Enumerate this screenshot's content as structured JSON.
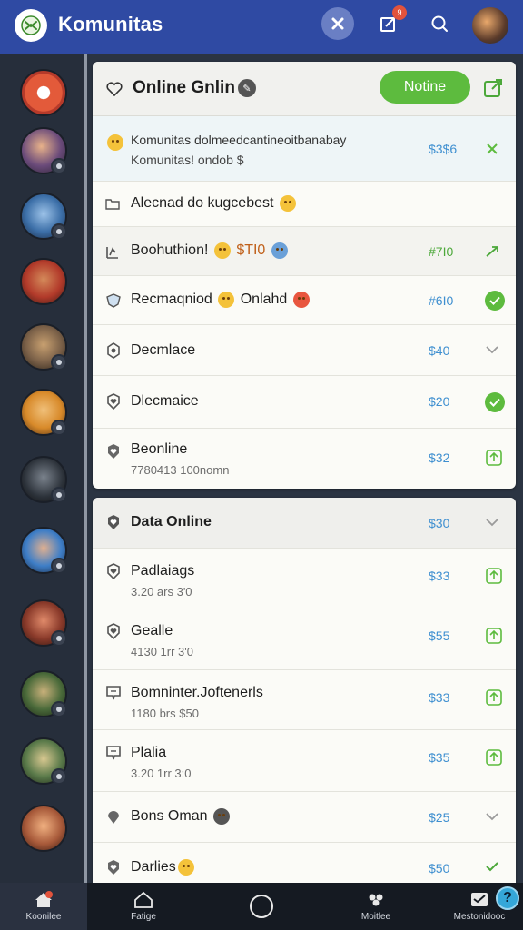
{
  "header": {
    "title": "Komunitas",
    "notification_count": "9"
  },
  "rail": {
    "avatars": [
      {
        "color": "#e35a3a"
      },
      {
        "color": "#6a4a7a"
      },
      {
        "color": "#3c6fa8"
      },
      {
        "color": "#b23a2a"
      },
      {
        "color": "#7a6048"
      },
      {
        "color": "#d88a2a"
      },
      {
        "color": "#2c323a"
      },
      {
        "color": "#3e7ec7"
      },
      {
        "color": "#8a3a2a"
      },
      {
        "color": "#4a6a3a"
      },
      {
        "color": "#5a7a4a"
      },
      {
        "color": "#a85a3a"
      }
    ]
  },
  "panel1": {
    "title": "Online Gnlin",
    "button": "Notine",
    "rows": [
      {
        "label": "Komunitas dolmeedcantineoitbanabay",
        "sub": "Komunitas! ondob $",
        "price": "$3$6"
      },
      {
        "label": "Alecnad do kugcebest"
      },
      {
        "label": "Boohuthion!",
        "tail": "$TI0",
        "price": "#7I0"
      },
      {
        "label": "Recmaqniod",
        "tail": "Onlahd",
        "price": "#6I0"
      },
      {
        "label": "Decmlace",
        "price": "$40"
      },
      {
        "label": "Dlecmaice",
        "price": "$20"
      },
      {
        "label": "Beonline",
        "sub": "7780413 100nomn",
        "price": "$32"
      }
    ]
  },
  "panel2": {
    "title": "Data Online",
    "title_price": "$30",
    "rows": [
      {
        "label": "Padlaiags",
        "sub": "3.20 ars 3'0",
        "price": "$33"
      },
      {
        "label": "Gealle",
        "sub": "4130 1rr 3'0",
        "price": "$55"
      },
      {
        "label": "Bomninter.Joftenerls",
        "sub": "1180 brs $50",
        "price": "$33"
      },
      {
        "label": "Plalia",
        "sub": "3.20 1rr 3:0",
        "price": "$35"
      },
      {
        "label": "Bons Oman",
        "price": "$25"
      },
      {
        "label": "Darlies",
        "price": "$50"
      }
    ]
  },
  "bottom_nav": {
    "items": [
      {
        "label": "Koonilee"
      },
      {
        "label": "Fatige"
      },
      {
        "label": ""
      },
      {
        "label": "Moitlee"
      },
      {
        "label": "Mestonidooc"
      }
    ],
    "help": "?"
  },
  "colors": {
    "accent_blue": "#2f4aa3",
    "accent_green": "#5dbb3e",
    "price_blue": "#3e8fd0"
  }
}
